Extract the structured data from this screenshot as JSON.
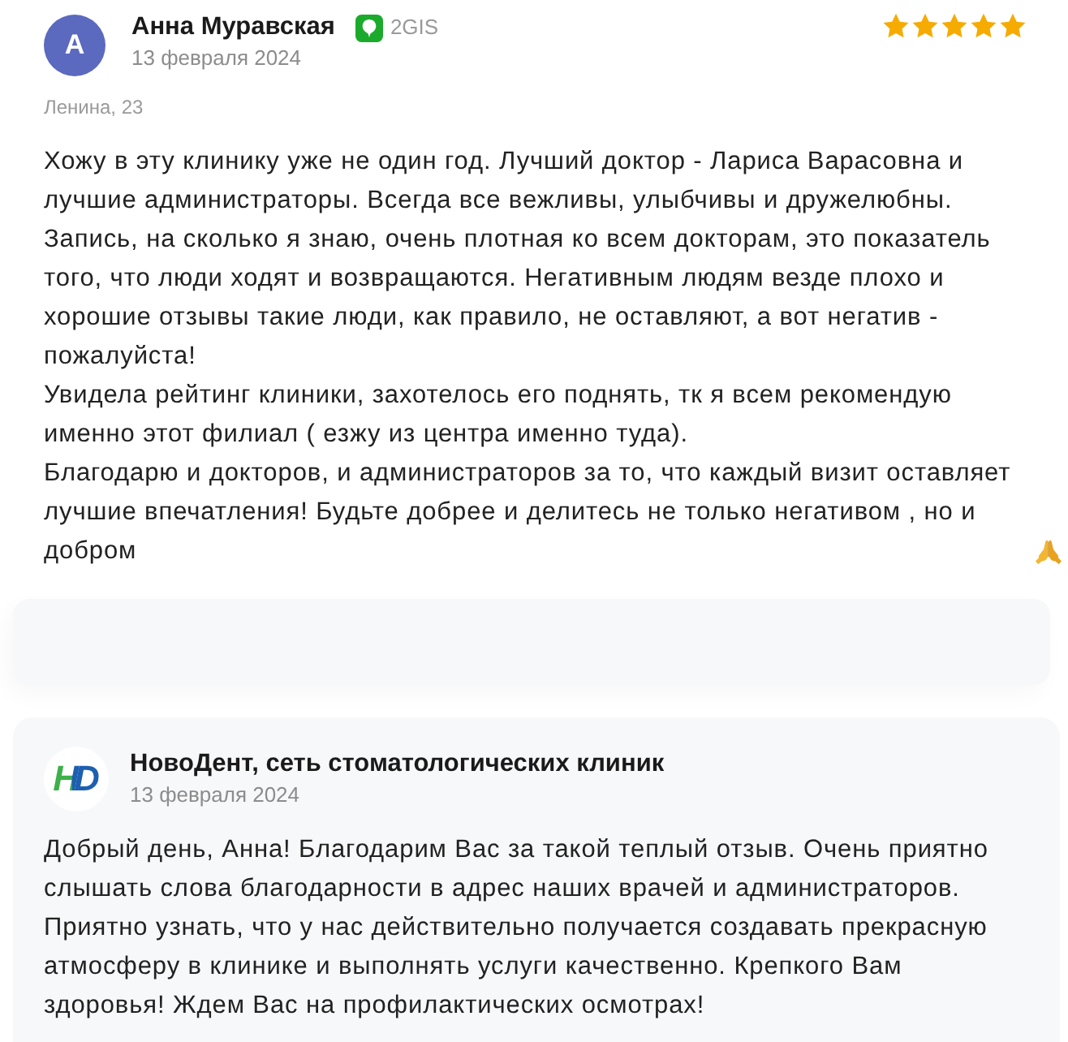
{
  "review": {
    "author": {
      "initial": "А",
      "name": "Анна Муравская",
      "source": "2GIS",
      "date": "13 февраля 2024"
    },
    "stars": 5,
    "address": "Ленина, 23",
    "paragraphs": [
      "Хожу в эту клинику уже не один год. Лучший доктор - Лариса Варасовна и лучшие администраторы. Всегда все вежливы, улыбчивы и дружелюбны. Запись, на сколько я знаю, очень плотная ко всем докторам, это показатель того, что люди ходят и возвращаются. Негативным людям везде плохо и хорошие отзывы такие люди, как правило, не оставляют, а вот негатив - пожалуйста!",
      "Увидела рейтинг клиники, захотелось его поднять, тк я всем рекомендую именно этот филиал ( езжу из центра именно туда).",
      "Благодарю и докторов, и администраторов за то, что каждый визит оставляет лучшие впечатления! Будьте добрее и делитесь не только негативом , но и добром"
    ]
  },
  "reply": {
    "logo_text": "HD",
    "name": "НовоДент, сеть стоматологических клиник",
    "date": "13 февраля 2024",
    "text": "Добрый день, Анна! Благодарим Вас за такой теплый отзыв. Очень приятно слышать слова благодарности в адрес наших врачей и администраторов. Приятно узнать, что у нас действительно получается создавать прекрасную атмосферу в клинике и выполнять услуги качественно. Крепкого Вам здоровья! Ждем Вас на профилактических осмотрах!"
  }
}
